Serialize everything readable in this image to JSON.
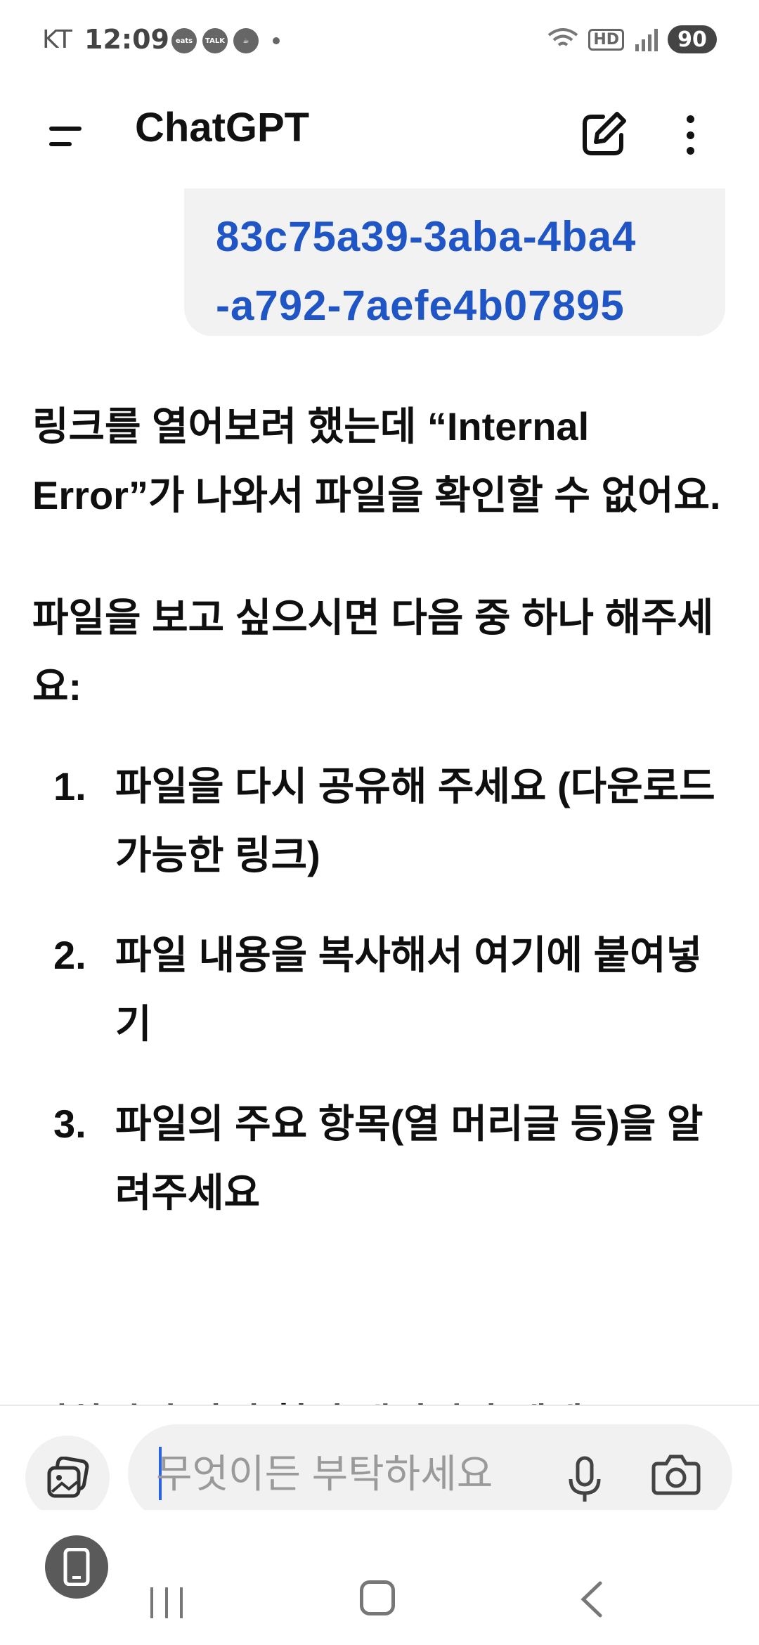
{
  "status_bar": {
    "carrier": "KT",
    "time": "12:09",
    "notif_icons": [
      "coupang-eats-icon",
      "kakaotalk-icon",
      "coffee-icon"
    ],
    "notif_eats": "eats",
    "notif_talk": "TALK",
    "hd": "HD",
    "battery": "90"
  },
  "app_bar": {
    "title": "ChatGPT"
  },
  "user_message": {
    "line1": "83c75a39-3aba-4ba4",
    "line2": "-a792-7aefe4b07895"
  },
  "assistant_message": {
    "para1": "링크를 열어보려 했는데 “Internal Error”가 나와서 파일을 확인할 수 없어요.",
    "para2": "파일을 보고 싶으시면 다음 중 하나 해주세요:",
    "options": [
      {
        "num": "1.",
        "text": "파일을 다시 공유해 주세요 (다운로드 가능한 링크)"
      },
      {
        "num": "2.",
        "text": "파일 내용을 복사해서 여기에 붙여넣기"
      },
      {
        "num": "3.",
        "text": "파일의 주요 항목(열 머리글 등)을 알려주세요"
      }
    ],
    "cut_line": "원하시면 파일 형식 해석이나 예제"
  },
  "input": {
    "placeholder": "무엇이든 부탁하세요"
  },
  "colors": {
    "link": "#1f55c4",
    "bubble": "#f2f2f2",
    "caret": "#2a62e6"
  }
}
